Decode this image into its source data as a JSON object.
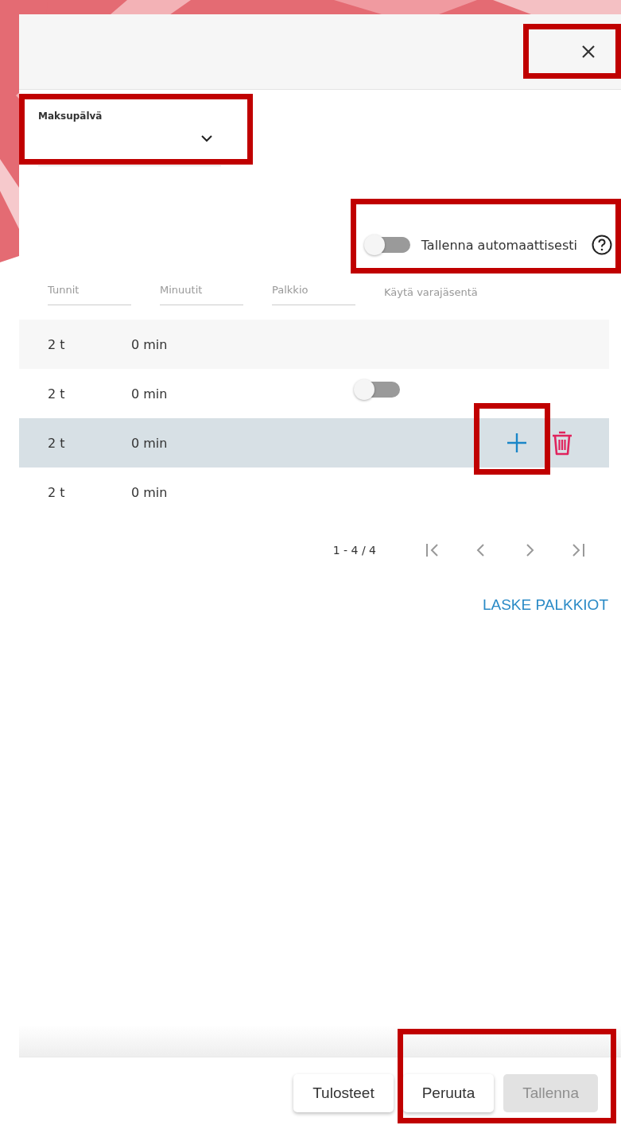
{
  "close_button": {
    "highlighted": true
  },
  "payment_day": {
    "label": "Maksupälvä",
    "highlighted": true
  },
  "autosave": {
    "label": "Tallenna automaattisesti",
    "on": false,
    "highlighted": true
  },
  "table": {
    "columns": [
      {
        "label": "Tunnit",
        "underlined": true
      },
      {
        "label": "Minuutit",
        "underlined": true
      },
      {
        "label": "Palkkio",
        "underlined": true
      },
      {
        "label": "Käytä varajäsentä",
        "underlined": false
      }
    ],
    "rows": [
      {
        "hours": "2 t",
        "minutes": "0 min",
        "selected": false
      },
      {
        "hours": "2 t",
        "minutes": "0 min",
        "selected": false,
        "substitute": {
          "on": false
        }
      },
      {
        "hours": "2 t",
        "minutes": "0 min",
        "selected": true,
        "add_highlighted": true
      },
      {
        "hours": "2 t",
        "minutes": "0 min",
        "selected": false
      }
    ]
  },
  "pagination": {
    "range": "1 - 4 / 4"
  },
  "calculate_link": "LASKE PALKKIOT",
  "buttons": [
    {
      "label": "Tulosteet",
      "disabled": false,
      "highlighted": false
    },
    {
      "label": "Peruuta",
      "disabled": false,
      "highlighted": true
    },
    {
      "label": "Tallenna",
      "disabled": true,
      "highlighted": true
    }
  ]
}
